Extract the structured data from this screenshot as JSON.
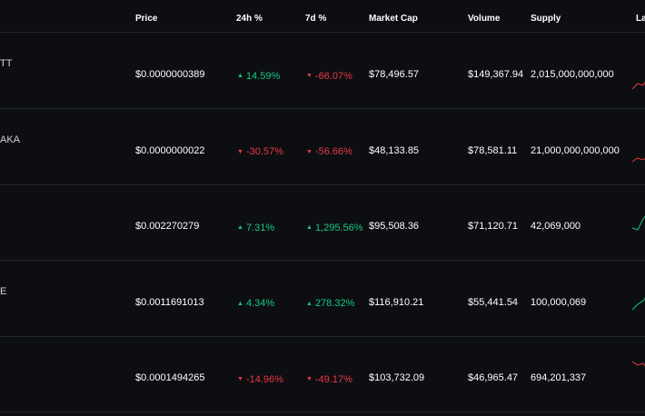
{
  "header": {
    "price": "Price",
    "change_24h": "24h %",
    "change_7d": "7d %",
    "market_cap": "Market Cap",
    "volume": "Volume",
    "supply": "Supply",
    "last": "La"
  },
  "colors": {
    "up": "#16c784",
    "down": "#ea3943",
    "background": "#0d0e12"
  },
  "rows": [
    {
      "name": "TT",
      "price": "$0.0000000389",
      "h24": {
        "dir": "up",
        "value": "14.59%"
      },
      "d7": {
        "dir": "down",
        "value": "-66.07%"
      },
      "market_cap": "$78,496.57",
      "volume": "$149,367.94",
      "supply": "2,015,000,000,000"
    },
    {
      "name": "AKA",
      "price": "$0.0000000022",
      "h24": {
        "dir": "down",
        "value": "-30.57%"
      },
      "d7": {
        "dir": "down",
        "value": "-56.66%"
      },
      "market_cap": "$48,133.85",
      "volume": "$78,581.11",
      "supply": "21,000,000,000,000"
    },
    {
      "name": "",
      "price": "$0.002270279",
      "h24": {
        "dir": "up",
        "value": "7.31%"
      },
      "d7": {
        "dir": "up",
        "value": "1,295.56%"
      },
      "market_cap": "$95,508.36",
      "volume": "$71,120.71",
      "supply": "42,069,000"
    },
    {
      "name": "E",
      "price": "$0.0011691013",
      "h24": {
        "dir": "up",
        "value": "4.34%"
      },
      "d7": {
        "dir": "up",
        "value": "278.32%"
      },
      "market_cap": "$116,910.21",
      "volume": "$55,441.54",
      "supply": "100,000,069"
    },
    {
      "name": "",
      "price": "$0.0001494265",
      "h24": {
        "dir": "down",
        "value": "-14.96%"
      },
      "d7": {
        "dir": "down",
        "value": "-49.17%"
      },
      "market_cap": "$103,732.09",
      "volume": "$46,965.47",
      "supply": "694,201,337"
    }
  ]
}
